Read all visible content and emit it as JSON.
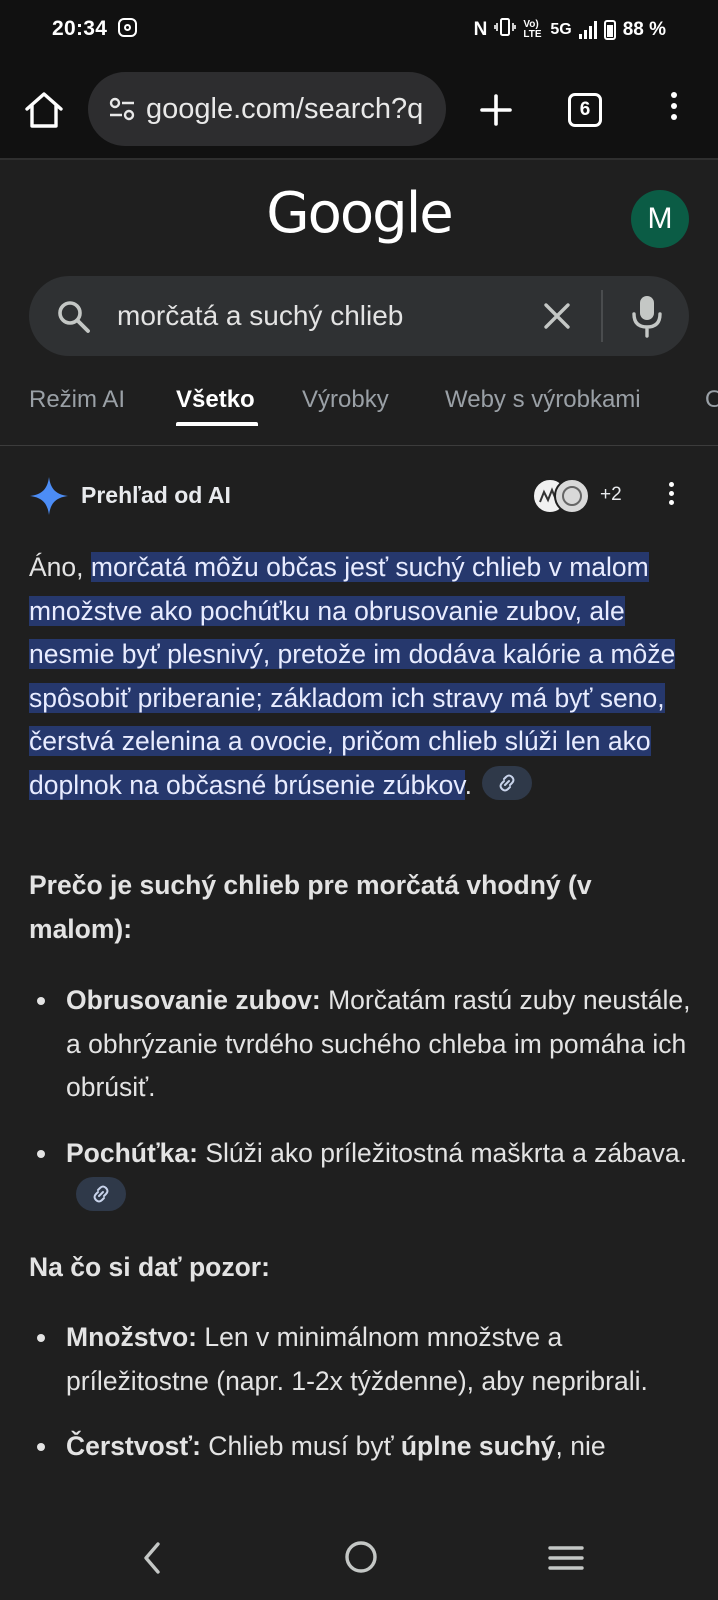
{
  "status_bar": {
    "time": "20:34",
    "network": "5G",
    "volte": "Vo) LTE",
    "battery": "88 %"
  },
  "browser": {
    "url": "google.com/search?q",
    "tab_count": "6",
    "icons": [
      "home-icon",
      "tune-icon",
      "plus-icon",
      "tabs-icon",
      "more-vert-icon"
    ]
  },
  "google": {
    "logo": "Google",
    "avatar_letter": "M",
    "avatar_color": "#0b5c45"
  },
  "search": {
    "query": "morčatá a suchý chlieb"
  },
  "tabs": [
    {
      "label": "Režim AI",
      "active": false
    },
    {
      "label": "Všetko",
      "active": true
    },
    {
      "label": "Výrobky",
      "active": false
    },
    {
      "label": "Weby s výrobkami",
      "active": false
    },
    {
      "label": "O",
      "active": false
    }
  ],
  "ai_overview": {
    "title": "Prehľad od AI",
    "sources_more": "+2",
    "answer_intro": "Áno, ",
    "answer_highlight": "morčatá môžu občas jesť suchý chlieb v malom množstve ako pochúťku na obrusovanie zubov, ale nesmie byť plesnivý, pretože im dodáva kalórie a môže spôsobiť priberanie; základom ich stravy má byť seno, čerstvá zelenina a ovocie, pričom chlieb slúži len ako doplnok na občasné brúsenie zúbkov",
    "answer_end": ".",
    "section1_heading": "Prečo je suchý chlieb pre morčatá vhodný (v malom):",
    "section1_items": [
      {
        "bold": "Obrusovanie zubov:",
        "text": " Morčatám rastú zuby neustále, a obhrýzanie tvrdého suchého chleba im pomáha ich obrúsiť."
      },
      {
        "bold": "Pochúťka:",
        "text": " Slúži ako príležitostná maškrta a zábava."
      }
    ],
    "section2_heading": "Na čo si dať pozor:",
    "section2_items": [
      {
        "bold": "Množstvo:",
        "text": " Len v minimálnom množstve a príležitostne (napr. 1-2x týždenne), aby nepribrali."
      },
      {
        "bold": "Čerstvosť:",
        "text": " Chlieb musí byť ",
        "bold2": "úplne suchý",
        "text2": ", nie"
      }
    ],
    "highlight_color": "#26386d",
    "accent_color": "#4c8df6"
  }
}
